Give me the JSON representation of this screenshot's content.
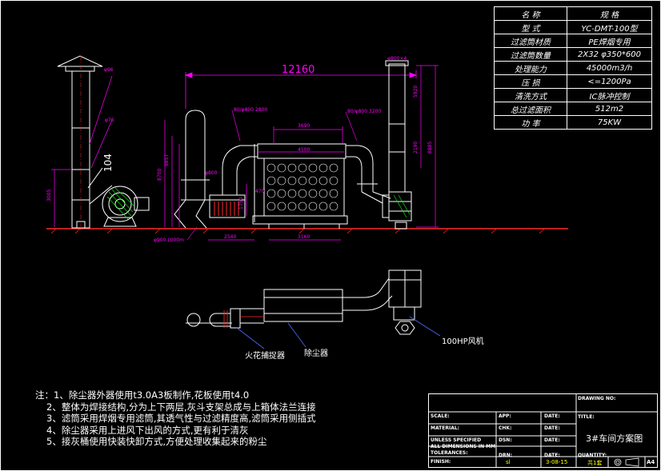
{
  "colors": {
    "background": "#000000",
    "dimension": "#ff00ff",
    "geometry": "#ffffff",
    "ground": "#ff2a2a",
    "cyan": "#00ffff",
    "yellow": "#ffff00",
    "green": "#00ff00",
    "blue": "#4a6cff"
  },
  "spec_table": {
    "header": [
      "名  称",
      "规  格"
    ],
    "rows": [
      [
        "型    式",
        "YC-DMT-100型"
      ],
      [
        "过滤筒材质",
        "PE焊烟专用"
      ],
      [
        "过滤筒数量",
        "2X32 φ350*600"
      ],
      [
        "处理能力",
        "45000m3/h"
      ],
      [
        "压    损",
        "<=1200Pa"
      ],
      [
        "清洗方式",
        "IC脉冲控制"
      ],
      [
        "总过滤面积",
        "512m2"
      ],
      [
        "功    率",
        "75KW"
      ]
    ]
  },
  "elevation": {
    "overall_length": "12160",
    "dim_3690": "3690",
    "dim_4500": "4500",
    "dim_2540": "2540",
    "dim_3160": "3160",
    "dim_104": "104",
    "dim_5920": "5920",
    "dim_2190": "2190",
    "dim_8885": "8885",
    "dim_3005": "3005",
    "dim_8700": "8700",
    "dim_2750": "2750",
    "dim_1750": "1750",
    "dim_470": "470",
    "dim_9857": "9857",
    "duct_label_left": "80/φ800 2800",
    "duct_label_right": "80/φ800 3200",
    "stack_label": "φ800×4",
    "pipe_label_1": "φ800",
    "pipe_label_2": "φ900 L000m",
    "cap_label": "φ96",
    "mid_label": "φ76"
  },
  "plan": {
    "fire_arrester": "火花捕捉器",
    "dust_collector": "除尘器",
    "fan": "100HP风机"
  },
  "notes": [
    "注：1、除尘器外器使用t3.0A3板制作,花板使用t4.0",
    "2、整体为焊接结构,分为上下两层,灰斗支架总成与上箱体法兰连接",
    "3、滤筒采用焊烟专用滤筒,其透气性与过滤精度高,滤筒采用侧插式",
    "4、除尘器采用上进风下出风的方式,更有利于清灰",
    "5、接灰桶使用快装快卸方式,方便处理收集起来的粉尘"
  ],
  "title_block": {
    "drawing_no_label": "DRAWING NO:",
    "title_label": "TITLE:",
    "title": "3#车间方案图",
    "scale_label": "SCALE:",
    "app_label": "APP:",
    "date_label": "DATE:",
    "material_label": "MATERIAL:",
    "chk_label": "CHK:",
    "unless_label": "UNLESS SPECIFIED",
    "all_dims_label": "ALL DIMENSIONS IN MM",
    "tolerances_label": "TOLERANCES:",
    "finish_label": "FINISH:",
    "dsn_label": "DSN:",
    "drn_label": "DRN:",
    "drn_value": "sl",
    "date_value": "3-08-15",
    "quantity_label": "QUANTITY:",
    "quantity_value": "共1套",
    "sheet": "A4"
  }
}
